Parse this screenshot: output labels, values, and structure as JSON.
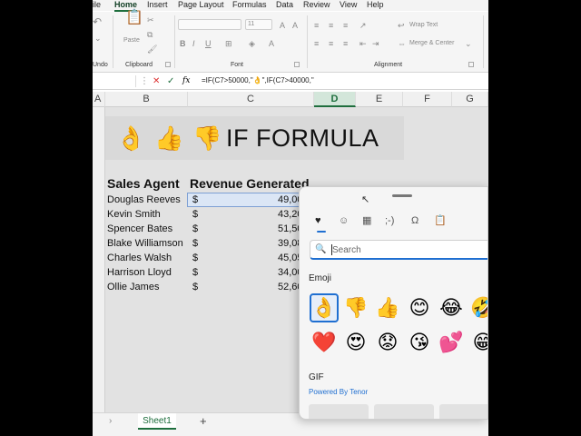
{
  "ribbon_tabs": [
    "ile",
    "Home",
    "Insert",
    "Page Layout",
    "Formulas",
    "Data",
    "Review",
    "View",
    "Help"
  ],
  "ribbon": {
    "undo_label": "Undo",
    "paste_label": "Paste",
    "clipboard_label": "Clipboard",
    "font_label": "Font",
    "font_size_value": "11",
    "alignment_label": "Alignment",
    "wrap_text_label": "Wrap Text",
    "merge_center_label": "Merge & Center"
  },
  "formula_bar": {
    "fx_label": "fx",
    "formula": "=IF(C7>50000,\"👌\",IF(C7>40000,\""
  },
  "columns": [
    "A",
    "B",
    "C",
    "D",
    "E",
    "F",
    "G"
  ],
  "banner": {
    "emojis": [
      "👌",
      "👍",
      "👎"
    ],
    "title": "IF FORMULA"
  },
  "table": {
    "header_agent": "Sales Agent",
    "header_revenue": "Revenue Generated",
    "currency": "$",
    "rows": [
      {
        "agent": "Douglas Reeves",
        "revenue": "49,00"
      },
      {
        "agent": "Kevin Smith",
        "revenue": "43,20"
      },
      {
        "agent": "Spencer Bates",
        "revenue": "51,50"
      },
      {
        "agent": "Blake Williamson",
        "revenue": "39,08"
      },
      {
        "agent": "Charles Walsh",
        "revenue": "45,05"
      },
      {
        "agent": "Harrison Lloyd",
        "revenue": "34,00"
      },
      {
        "agent": "Ollie James",
        "revenue": "52,60"
      }
    ]
  },
  "sheet_tabs": {
    "prev": "›",
    "active": "Sheet1",
    "add": "+"
  },
  "emoji_panel": {
    "tabs": [
      "♥",
      "☺",
      "▦",
      ";-)",
      "Ω",
      "📋"
    ],
    "search_placeholder": "Search",
    "emoji_section": "Emoji",
    "emojis_row1": [
      "👌",
      "👎",
      "👍",
      "😊",
      "😂",
      "🤣"
    ],
    "emojis_row2": [
      "❤️",
      "😍",
      "😟",
      "😘",
      "💕",
      "😁"
    ],
    "gif_section": "GIF",
    "gif_provider": "Powered By Tenor"
  },
  "colors": {
    "excel_green": "#1e6e3d",
    "selection_blue": "#1f6fd1"
  }
}
